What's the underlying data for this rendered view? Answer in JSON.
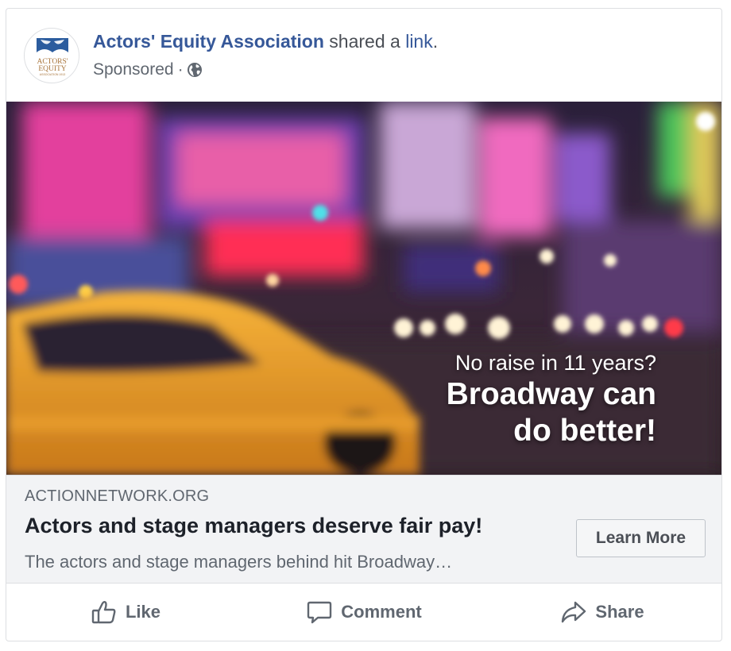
{
  "post": {
    "page_name": "Actors' Equity Association",
    "shared_text": "shared a",
    "link_word": "link",
    "period": ".",
    "sponsored": "Sponsored",
    "separator": "·",
    "audience_icon": "globe-icon"
  },
  "avatar": {
    "logo_line1": "ACTORS'",
    "logo_line2": "EQUITY",
    "logo_line3": "ASSOCIATION 1913",
    "mask_color": "#2b5c9e",
    "text_color": "#a8743a"
  },
  "image": {
    "overlay_line1": "No raise in 11 years?",
    "overlay_line2": "Broadway can",
    "overlay_line3": "do better!"
  },
  "link_preview": {
    "domain": "ACTIONNETWORK.ORG",
    "title": "Actors and stage managers deserve fair pay!",
    "description": "The actors and stage managers behind hit Broadway…",
    "cta_label": "Learn More"
  },
  "actions": [
    {
      "label": "Like",
      "icon": "thumbs-up-icon"
    },
    {
      "label": "Comment",
      "icon": "comment-icon"
    },
    {
      "label": "Share",
      "icon": "share-arrow-icon"
    }
  ],
  "colors": {
    "link_blue": "#365899",
    "muted_text": "#606770",
    "preview_bg": "#f2f3f5"
  }
}
